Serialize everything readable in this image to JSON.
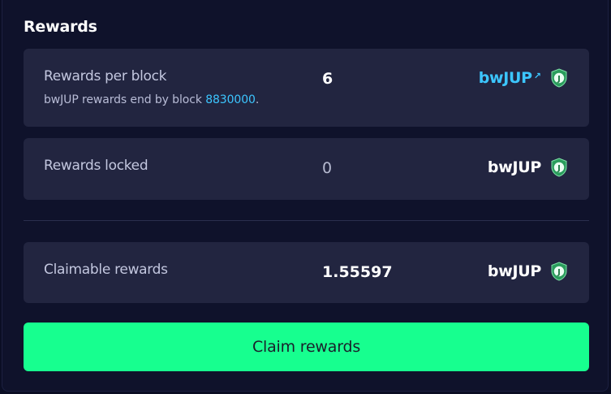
{
  "section": {
    "title": "Rewards"
  },
  "rewards_per_block": {
    "label": "Rewards per block",
    "sub_prefix": "bwJUP rewards end by block ",
    "end_block": "8830000",
    "sub_suffix": ".",
    "value": "6",
    "token": "bwJUP",
    "token_icon": "jupiter-token-icon",
    "link_icon": "external-link-icon"
  },
  "rewards_locked": {
    "label": "Rewards locked",
    "value": "0",
    "token": "bwJUP",
    "token_icon": "jupiter-token-icon"
  },
  "claimable_rewards": {
    "label": "Claimable rewards",
    "value": "1.55597",
    "token": "bwJUP",
    "token_icon": "jupiter-token-icon"
  },
  "claim_button": {
    "label": "Claim rewards"
  },
  "colors": {
    "background": "#0f122b",
    "card": "#222540",
    "accent_link": "#3cc6ff",
    "button": "#17ff8f",
    "coin": "#2a9d5c"
  }
}
